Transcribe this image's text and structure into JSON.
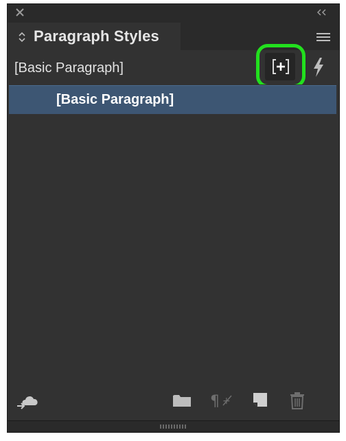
{
  "panel": {
    "tab_label": "Paragraph Styles"
  },
  "current_style": {
    "label": "[Basic Paragraph]"
  },
  "styles_list": {
    "items": [
      {
        "label": "[Basic Paragraph]",
        "selected": true
      }
    ]
  },
  "icons": {
    "close": "close-icon",
    "collapse": "double-chevron-left-icon",
    "panel_menu": "hamburger-menu-icon",
    "new_style_from_selection": "new-style-bracket-plus-icon",
    "quick_apply": "lightning-bolt-icon",
    "cc_library": "cloud-library-icon",
    "new_group": "folder-icon",
    "clear_overrides": "pilcrow-clear-overrides-icon",
    "new_style": "new-style-page-icon",
    "delete": "trash-icon"
  },
  "colors": {
    "panel_bg": "#323232",
    "selected_row": "#3d5673",
    "highlight_ring": "#22e01e"
  }
}
